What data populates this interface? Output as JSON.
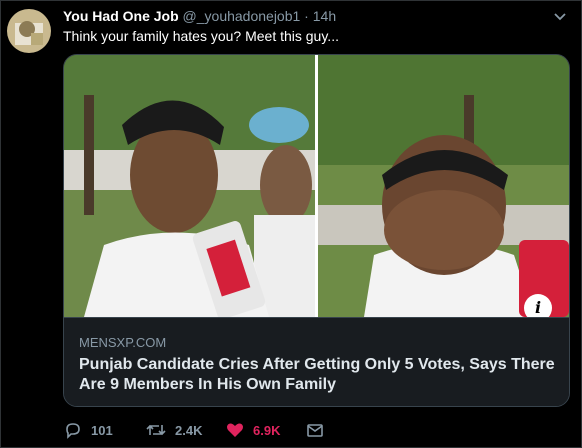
{
  "tweet": {
    "author_name": "You Had One Job",
    "handle": "@_youhadonejob1",
    "separator": " · ",
    "time": "14h",
    "text": "Think your family hates you? Meet this guy..."
  },
  "card": {
    "domain": "MENSXP.COM",
    "title": "Punjab Candidate Cries After Getting Only 5 Votes, Says There Are 9 Members In His Own Family",
    "info_label": "i"
  },
  "actions": {
    "replies": "101",
    "retweets": "2.4K",
    "likes": "6.9K"
  },
  "colors": {
    "background": "#000000",
    "like_accent": "#e0245e",
    "muted": "#8899a6"
  },
  "icons": [
    "chevron-down-icon",
    "info-icon",
    "reply-icon",
    "retweet-icon",
    "heart-icon",
    "mail-icon"
  ]
}
